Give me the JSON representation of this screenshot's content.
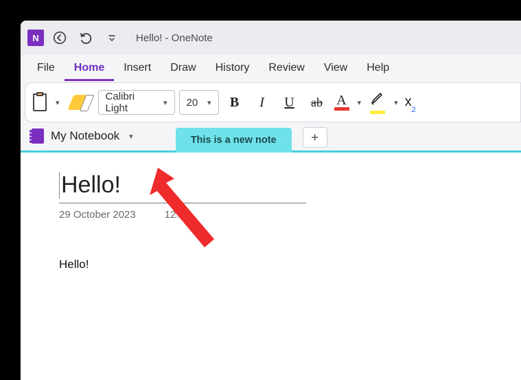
{
  "titlebar": {
    "title": "Hello!  -  OneNote"
  },
  "menu": {
    "file": "File",
    "home": "Home",
    "insert": "Insert",
    "draw": "Draw",
    "history": "History",
    "review": "Review",
    "view": "View",
    "help": "Help"
  },
  "ribbon": {
    "font_name": "Calibri Light",
    "font_size": "20",
    "bold": "B",
    "italic": "I",
    "underline": "U",
    "strike": "ab",
    "fontcolor_glyph": "A",
    "subscript_base": "x",
    "subscript_sub": "2"
  },
  "notebook": {
    "name": "My Notebook"
  },
  "tabs": {
    "active": "This is a new note",
    "add": "+"
  },
  "page": {
    "title": "Hello!",
    "date": "29 October 2023",
    "time": "12:00",
    "body": "Hello!"
  }
}
